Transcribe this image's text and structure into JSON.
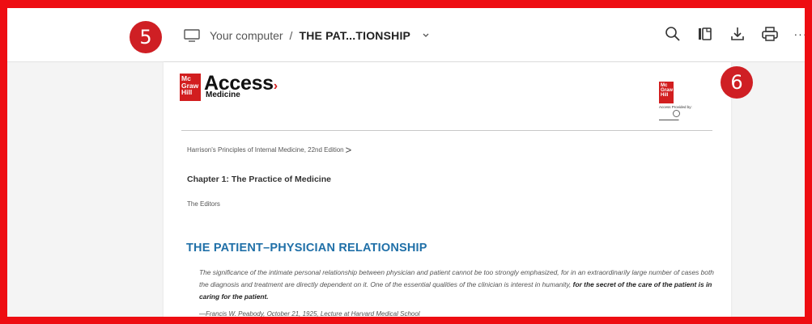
{
  "breadcrumb": {
    "location": "Your computer",
    "separator": "/",
    "filename": "THE PAT...TIONSHIP"
  },
  "toolbar": {
    "icons": [
      "search-icon",
      "page-view-icon",
      "download-icon",
      "print-icon",
      "more-icon"
    ],
    "more_label": "···"
  },
  "badges": {
    "left": "5",
    "right": "6"
  },
  "document": {
    "logo": {
      "mcgraw": [
        "Mc",
        "Graw",
        "Hill"
      ],
      "access": "Access",
      "medicine": "Medicine"
    },
    "publisher": {
      "mcgraw": [
        "Mc",
        "Graw",
        "Hill"
      ],
      "provided_by": "Access Provided by:"
    },
    "book_title": "Harrison's Principles of Internal Medicine, 22nd Edition",
    "chapter_title": "Chapter 1: The Practice of Medicine",
    "authors": "The Editors",
    "section_heading": "THE PATIENT–PHYSICIAN RELATIONSHIP",
    "quote_text": "The significance of the intimate personal relationship between physician and patient cannot be too strongly emphasized, for in an extraordinarily large number of cases both the diagnosis and treatment are directly dependent on it. One of the essential qualities of the clinician is interest in humanity, ",
    "quote_bold": "for the secret of the care of the patient is in caring for the patient.",
    "attribution": "—Francis W. Peabody, October 21, 1925, Lecture at Harvard Medical School"
  },
  "colors": {
    "annotation_red": "#ee0d12",
    "badge_red": "#cf1f24",
    "brand_red": "#d21e1f",
    "heading_blue": "#2070a8"
  }
}
